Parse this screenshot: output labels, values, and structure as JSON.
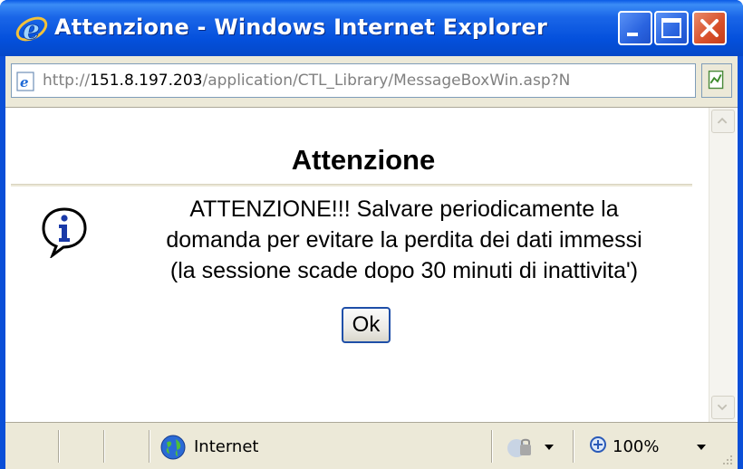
{
  "window": {
    "title": "Attenzione - Windows Internet Explorer",
    "buttons": {
      "minimize": "minimize",
      "maximize": "maximize",
      "close": "close"
    }
  },
  "address_bar": {
    "url_prefix": "http://",
    "url_host": "151.8.197.203",
    "url_path": "/application/CTL_Library/MessageBoxWin.asp?N"
  },
  "dialog": {
    "title": "Attenzione",
    "message_lines": [
      "ATTENZIONE!!! Salvare periodicamente la",
      "domanda per evitare la perdita dei dati immessi",
      "(la sessione scade dopo 30 minuti di inattivita')"
    ],
    "ok_label": "Ok",
    "icon": "info-icon"
  },
  "status_bar": {
    "zone": "Internet",
    "zoom": "100%"
  },
  "colors": {
    "titlebar": "#0a4fd8",
    "close_button": "#d8502a",
    "chrome": "#ece9d8"
  }
}
